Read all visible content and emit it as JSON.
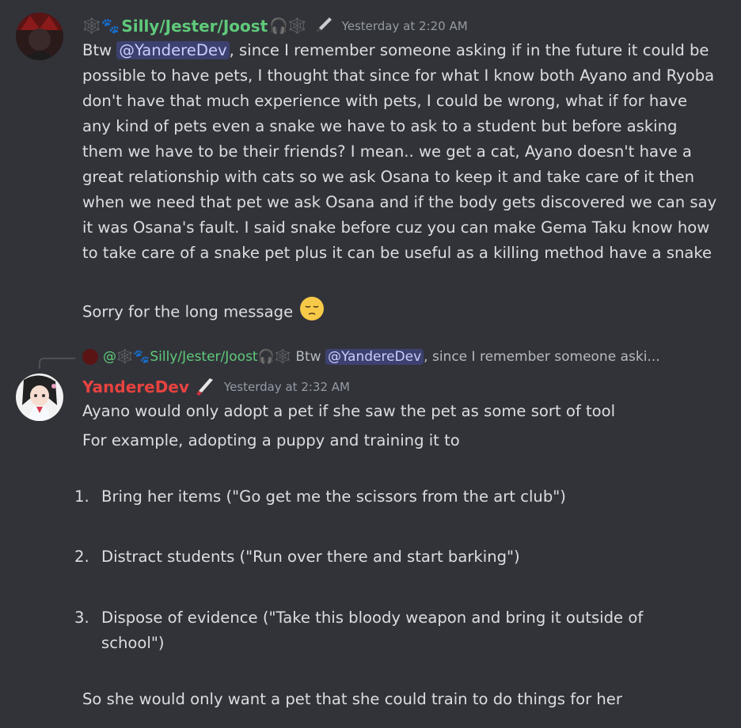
{
  "message1": {
    "name_prefix_icons": "🕸️🐾",
    "username": "Silly/Jester/Joost",
    "name_suffix_icons": "🎧🕸️",
    "badge_icon": "pen-icon",
    "timestamp": "Yesterday at 2:20 AM",
    "line1_before": "Btw ",
    "mention": "@YandereDev",
    "line1_after": ", since I remember someone asking if in the future it could be possible to have pets, I thought that since for what I know both Ayano and Ryoba don't have that much experience with pets, I could be wrong, what if for have any kind of pets even a snake we have to ask to a student but before asking them we have to be their friends? I mean.. we get a cat, Ayano doesn't have a great relationship with cats so we ask Osana to keep it and take care of it then when we need that pet we ask Osana and if the body gets discovered we can say it was Osana's fault. I said snake before cuz you can make Gema Taku know how to take care of a snake pet plus it can be useful as a killing method have a snake",
    "line2": "Sorry for the long message",
    "line2_emoji": "😔"
  },
  "reply": {
    "at_prefix": "@",
    "prefix_icons": "🕸️🐾",
    "username": "Silly/Jester/Joost",
    "suffix_icons": "🎧🕸️",
    "text_before": " Btw ",
    "mention": "@YandereDev",
    "text_after": ", since I remember someone aski..."
  },
  "message2": {
    "username": "YandereDev",
    "badge_icon": "knife-icon",
    "timestamp": "Yesterday at 2:32 AM",
    "line1": "Ayano would only adopt a pet if she saw the pet as some sort of tool",
    "line2": "For example, adopting a puppy and training it to",
    "list": [
      {
        "num": "1.",
        "text": "Bring her items (\"Go get me the scissors from the art club\")"
      },
      {
        "num": "2.",
        "text": "Distract students (\"Run over there and start barking\")"
      },
      {
        "num": "3.",
        "text": "Dispose of evidence (\"Take this bloody weapon and bring it outside of school\")"
      }
    ],
    "closing": "So she would only want a pet that she could train to do things for her"
  },
  "colors": {
    "background": "#323339",
    "username_green": "#5fca7a",
    "username_red": "#e8423f",
    "mention_bg": "rgba(88,101,242,0.3)",
    "text": "#dbdee1",
    "timestamp": "#949ba4"
  }
}
